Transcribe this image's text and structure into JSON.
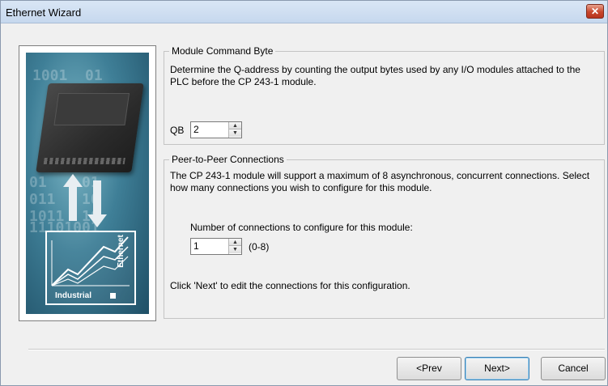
{
  "window": {
    "title": "Ethernet Wizard",
    "close_glyph": "✕"
  },
  "image_panel": {
    "icon": "plc-network-illustration",
    "badge_word_horizontal": "Industrial",
    "badge_word_vertical": "Ethernet"
  },
  "module_command_byte": {
    "legend": "Module Command Byte",
    "description": "Determine the Q-address by counting the output bytes used by any I/O modules attached to the PLC before the CP 243-1 module.",
    "field_label": "QB",
    "field_value": "2"
  },
  "peer_connections": {
    "legend": "Peer-to-Peer Connections",
    "description": "The CP 243-1 module will support a maximum of 8 asynchronous, concurrent connections. Select how many connections you wish to configure for this module.",
    "count_label": "Number of connections to configure for this module:",
    "count_value": "1",
    "range_hint": "(0-8)",
    "next_hint": "Click 'Next' to edit the connections for this configuration."
  },
  "buttons": {
    "prev": "<Prev",
    "next": "Next>",
    "cancel": "Cancel"
  },
  "colors": {
    "title_bar": "#c6d8ee",
    "close_button": "#c7452b",
    "panel_bg": "#f0f0f0",
    "default_button_border": "#3c7fb1"
  }
}
